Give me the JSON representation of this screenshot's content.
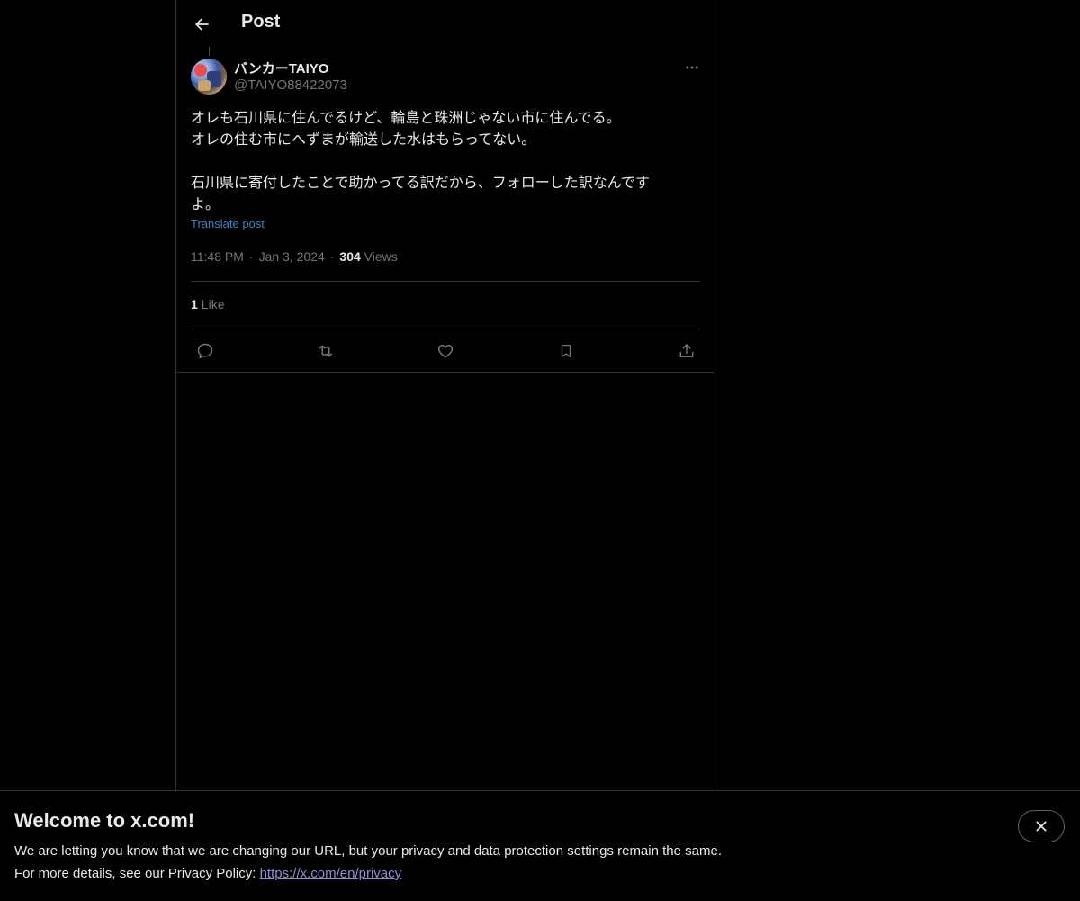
{
  "header": {
    "title": "Post"
  },
  "post": {
    "author": {
      "display_name": "バンカーTAIYO",
      "handle": "@TAIYO88422073"
    },
    "text": "オレも石川県に住んでるけど、輪島と珠洲じゃない市に住んでる。\nオレの住む市にへずまが輸送した水はもらってない。\n\n石川県に寄付したことで助かってる訳だから、フォローした訳なんです\nよ。",
    "translate_label": "Translate post",
    "time": "11:48 PM",
    "date": "Jan 3, 2024",
    "views_count": "304",
    "views_label": "Views",
    "dot": "·",
    "likes_count": "1",
    "likes_label": "Like"
  },
  "actions": [
    {
      "icon": "reply-icon"
    },
    {
      "icon": "repost-icon"
    },
    {
      "icon": "like-icon"
    },
    {
      "icon": "bookmark-icon"
    },
    {
      "icon": "share-icon"
    }
  ],
  "banner": {
    "title": "Welcome to x.com!",
    "line1": "We are letting you know that we are changing our URL, but your privacy and data protection settings remain the same.",
    "line2_prefix": "For more details, see our Privacy Policy: ",
    "link": "https://x.com/en/privacy"
  },
  "colors": {
    "background": "#000000",
    "text": "#e7e9ea",
    "muted": "#71767b",
    "link": "#3b82c4",
    "border": "#2f3336"
  }
}
